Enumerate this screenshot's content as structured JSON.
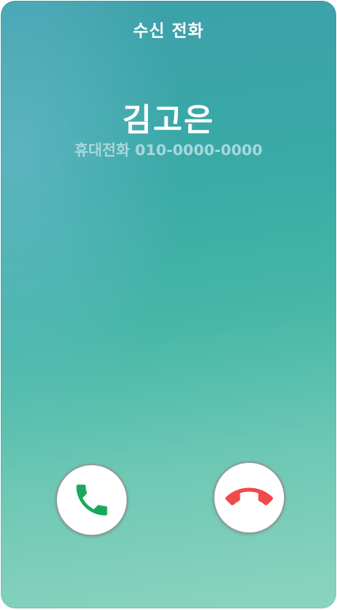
{
  "screen": {
    "title": "수신 전화"
  },
  "caller": {
    "name": "김고은",
    "number": "휴대전화 010-0000-0000"
  },
  "actions": {
    "accept_icon": "phone-icon",
    "decline_icon": "phone-hangup-icon"
  },
  "colors": {
    "accept": "#1aa85a",
    "decline": "#f04a4a",
    "background_top": "#3da0ab",
    "background_bottom": "#8cd4bf"
  }
}
